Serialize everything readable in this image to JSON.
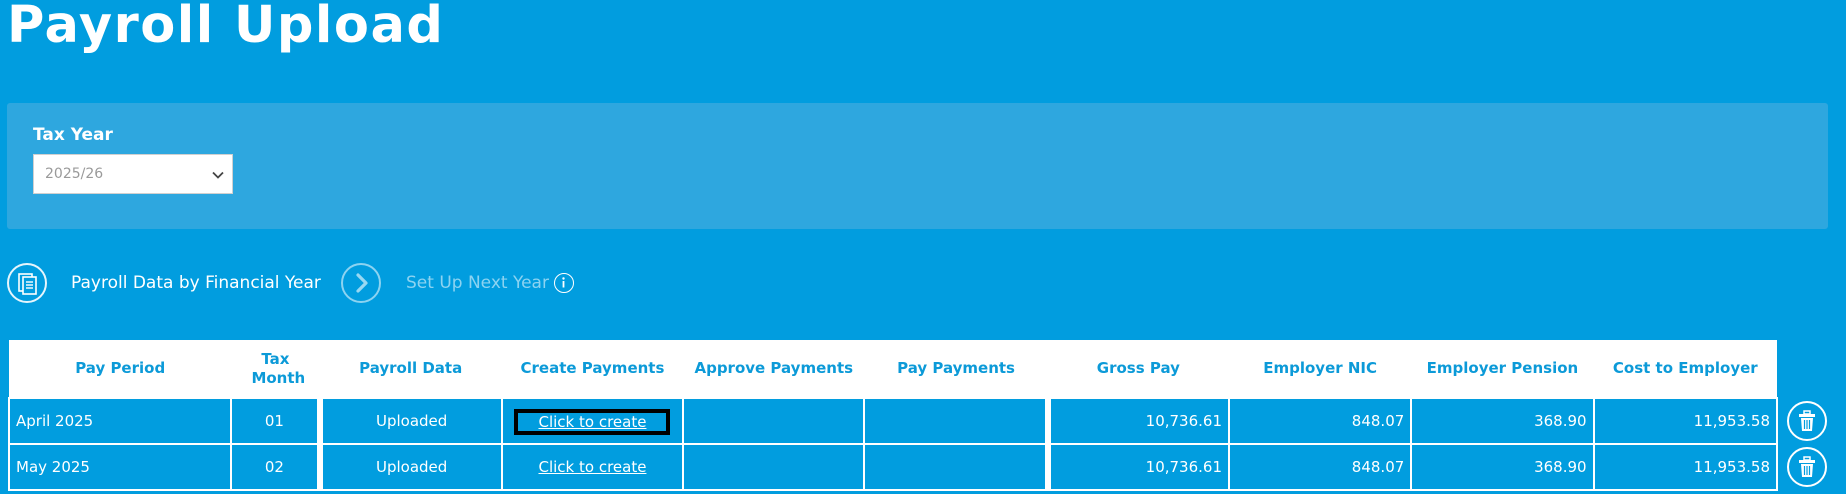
{
  "page": {
    "title": "Payroll Upload"
  },
  "filter": {
    "tax_year_label": "Tax Year",
    "tax_year_value": "2025/26"
  },
  "toolbar": {
    "payroll_data_label": "Payroll Data by Financial Year",
    "next_year_label": "Set Up Next Year",
    "payroll_data_icon": "documents-icon",
    "next_year_icon": "chevron-right-icon",
    "info_icon": "info-icon"
  },
  "table": {
    "headers": {
      "pay_period": "Pay Period",
      "tax_month": "Tax Month",
      "payroll_data": "Payroll Data",
      "create_payments": "Create Payments",
      "approve_payments": "Approve Payments",
      "pay_payments": "Pay Payments",
      "gross_pay": "Gross Pay",
      "employer_nic": "Employer NIC",
      "employer_pension": "Employer Pension",
      "cost_to_employer": "Cost to Employer"
    },
    "rows": [
      {
        "pay_period": "April 2025",
        "tax_month": "01",
        "payroll_data": "Uploaded",
        "create_payments": "Click to create",
        "approve_payments": "",
        "pay_payments": "",
        "gross_pay": "10,736.61",
        "employer_nic": "848.07",
        "employer_pension": "368.90",
        "cost_to_employer": "11,953.58"
      },
      {
        "pay_period": "May 2025",
        "tax_month": "02",
        "payroll_data": "Uploaded",
        "create_payments": "Click to create",
        "approve_payments": "",
        "pay_payments": "",
        "gross_pay": "10,736.61",
        "employer_nic": "848.07",
        "employer_pension": "368.90",
        "cost_to_employer": "11,953.58"
      }
    ]
  },
  "colors": {
    "background": "#019ddf",
    "panel": "#2ea7df",
    "header_text": "#0c9ad8",
    "focus_outline": "#000000"
  }
}
